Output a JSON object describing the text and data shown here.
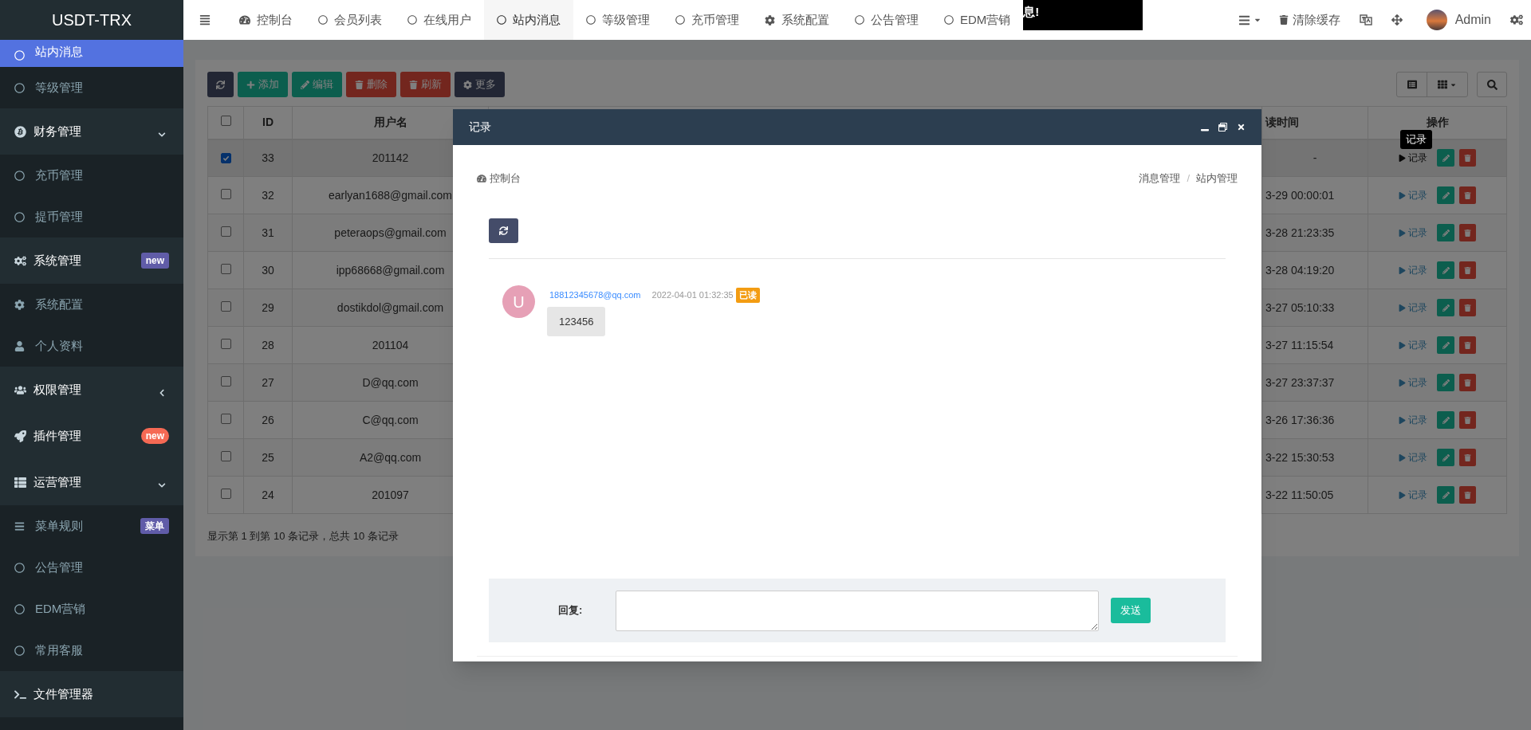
{
  "brand": "USDT-TRX",
  "top_nav": {
    "tabs": [
      {
        "label": "控制台",
        "kind": "dashboard",
        "selected": false
      },
      {
        "label": "会员列表",
        "kind": "page",
        "selected": false
      },
      {
        "label": "在线用户",
        "kind": "page",
        "selected": false
      },
      {
        "label": "站内消息",
        "kind": "page",
        "selected": true
      },
      {
        "label": "等级管理",
        "kind": "page",
        "selected": false
      },
      {
        "label": "充币管理",
        "kind": "page",
        "selected": false
      },
      {
        "label": "系统配置",
        "kind": "settings",
        "selected": false
      },
      {
        "label": "公告管理",
        "kind": "page",
        "selected": false
      },
      {
        "label": "EDM营销",
        "kind": "page",
        "selected": false
      }
    ],
    "notice": "息!",
    "cache_button": "清除缓存",
    "user": "Admin"
  },
  "sidebar": {
    "items": [
      {
        "label": "站内消息",
        "kind": "item",
        "selected": true
      },
      {
        "label": "等级管理",
        "kind": "item",
        "selected": false
      },
      {
        "label": "财务管理",
        "kind": "group",
        "expanded": true,
        "selected": false
      },
      {
        "label": "充币管理",
        "kind": "item",
        "selected": false
      },
      {
        "label": "提币管理",
        "kind": "item",
        "selected": false
      },
      {
        "label": "系统管理",
        "kind": "group",
        "badge": {
          "text": "new",
          "color": "#605ca8"
        },
        "selected": false
      },
      {
        "label": "系统配置",
        "kind": "item",
        "selected": false
      },
      {
        "label": "个人资料",
        "kind": "item",
        "selected": false
      },
      {
        "label": "权限管理",
        "kind": "group",
        "expanded": false,
        "selected": false
      },
      {
        "label": "插件管理",
        "kind": "group",
        "badge": {
          "text": "new",
          "color": "#f56954"
        },
        "selected": false
      },
      {
        "label": "运营管理",
        "kind": "group",
        "expanded": true,
        "selected": false
      },
      {
        "label": "菜单规则",
        "kind": "item",
        "badge": {
          "text": "菜单",
          "color": "#605ca8"
        },
        "selected": false
      },
      {
        "label": "公告管理",
        "kind": "item",
        "selected": false
      },
      {
        "label": "EDM营销",
        "kind": "item",
        "selected": false
      },
      {
        "label": "常用客服",
        "kind": "item",
        "selected": false
      },
      {
        "label": "文件管理器",
        "kind": "group",
        "selected": false
      }
    ]
  },
  "toolbar": {
    "buttons": [
      {
        "kind": "refresh"
      },
      {
        "kind": "add",
        "label": "添加"
      },
      {
        "kind": "edit",
        "label": "编辑"
      },
      {
        "kind": "delete",
        "label": "删除"
      },
      {
        "kind": "clear",
        "label": "刷新"
      },
      {
        "kind": "more",
        "label": "更多"
      }
    ]
  },
  "table": {
    "select_all": false,
    "columns": [
      "ID",
      "用户名",
      "读时间",
      "操作"
    ],
    "rows": [
      {
        "id": "33",
        "username": "201142",
        "read_time": "-",
        "action": "记录",
        "selected": true,
        "hovered": true
      },
      {
        "id": "32",
        "username": "earlyan1688@gmail.com",
        "read_time": "3-29 00:00:01",
        "action": "记录",
        "selected": false,
        "hovered": false
      },
      {
        "id": "31",
        "username": "peteraops@gmail.com",
        "read_time": "3-28 21:23:35",
        "action": "记录",
        "selected": false,
        "hovered": false
      },
      {
        "id": "30",
        "username": "ipp68668@gmail.com",
        "read_time": "3-28 04:19:20",
        "action": "记录",
        "selected": false,
        "hovered": false
      },
      {
        "id": "29",
        "username": "dostikdol@gmail.com",
        "read_time": "3-27 05:10:33",
        "action": "记录",
        "selected": false,
        "hovered": false
      },
      {
        "id": "28",
        "username": "201104",
        "read_time": "3-27 11:15:54",
        "action": "记录",
        "selected": false,
        "hovered": false
      },
      {
        "id": "27",
        "username": "D@qq.com",
        "read_time": "3-27 23:37:37",
        "action": "记录",
        "selected": false,
        "hovered": false
      },
      {
        "id": "26",
        "username": "C@qq.com",
        "read_time": "3-26 17:36:36",
        "action": "记录",
        "selected": false,
        "hovered": false
      },
      {
        "id": "25",
        "username": "A2@qq.com",
        "read_time": "3-22 15:30:53",
        "action": "记录",
        "selected": false,
        "hovered": false
      },
      {
        "id": "24",
        "username": "201097",
        "read_time": "3-22 11:50:05",
        "action": "记录",
        "selected": false,
        "hovered": false
      }
    ]
  },
  "tooltip": "记录",
  "footer": "显示第 1 到第 10 条记录，总共 10 条记录",
  "modal": {
    "title": "记录",
    "breadcrumb_home": "控制台",
    "breadcrumb": [
      "消息管理",
      "站内管理"
    ],
    "breadcrumb_separator": "/",
    "messages": [
      {
        "avatar": "U",
        "sender": "18812345678@qq.com",
        "time": "2022-04-01 01:32:35",
        "status": "已读",
        "text": "123456"
      }
    ],
    "reply_label": "回复:",
    "send_button": "发送"
  }
}
